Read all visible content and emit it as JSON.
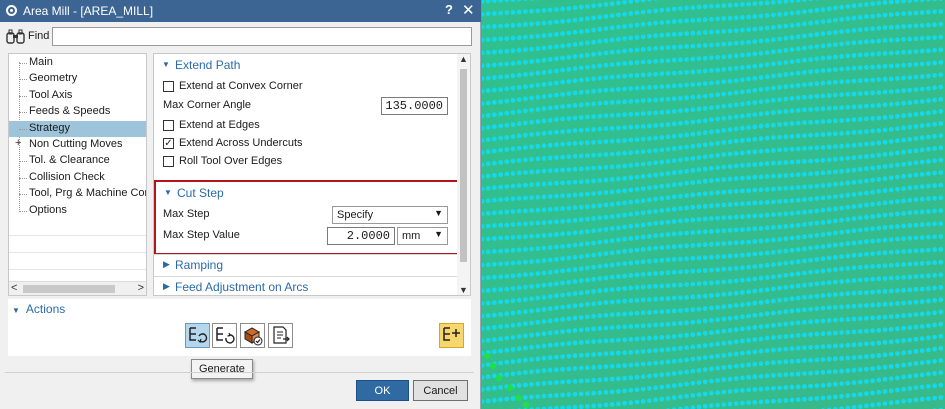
{
  "titlebar": {
    "title": "Area Mill - [AREA_MILL]",
    "help": "?",
    "close": "✕"
  },
  "find": {
    "label": "Find",
    "value": ""
  },
  "tree": {
    "items": [
      {
        "label": "Main",
        "selected": false,
        "expandable": false
      },
      {
        "label": "Geometry",
        "selected": false,
        "expandable": false
      },
      {
        "label": "Tool Axis",
        "selected": false,
        "expandable": false
      },
      {
        "label": "Feeds & Speeds",
        "selected": false,
        "expandable": false
      },
      {
        "label": "Strategy",
        "selected": true,
        "expandable": false
      },
      {
        "label": "Non Cutting Moves",
        "selected": false,
        "expandable": true
      },
      {
        "label": "Tol. & Clearance",
        "selected": false,
        "expandable": false
      },
      {
        "label": "Collision Check",
        "selected": false,
        "expandable": false
      },
      {
        "label": "Tool, Prg & Machine Contr",
        "selected": false,
        "expandable": false
      },
      {
        "label": "Options",
        "selected": false,
        "expandable": false
      }
    ]
  },
  "extend_path": {
    "header": "Extend Path",
    "extend_at_convex_corner": {
      "label": "Extend at Convex Corner",
      "checked": false
    },
    "max_corner_angle": {
      "label": "Max Corner Angle",
      "value": "135.0000"
    },
    "extend_at_edges": {
      "label": "Extend at Edges",
      "checked": false
    },
    "extend_across_undercuts": {
      "label": "Extend Across Undercuts",
      "checked": true
    },
    "roll_tool_over_edges": {
      "label": "Roll Tool Over Edges",
      "checked": false
    }
  },
  "cut_step": {
    "header": "Cut Step",
    "max_step": {
      "label": "Max Step",
      "value": "Specify"
    },
    "max_step_value": {
      "label": "Max Step Value",
      "value": "2.0000",
      "unit": "mm"
    },
    "highlight_color": "#b4141e"
  },
  "ramping": {
    "header": "Ramping"
  },
  "feed_adjustment": {
    "header": "Feed Adjustment on Arcs"
  },
  "actions": {
    "header": "Actions",
    "buttons": [
      "generate-icon",
      "replay-icon",
      "verify-icon",
      "list-icon",
      "toolpath-edit-icon"
    ]
  },
  "tooltip": "Generate",
  "footer": {
    "ok": "OK",
    "cancel": "Cancel"
  },
  "colors": {
    "titlebar": "#3c6593",
    "accent_text": "#2b6aa8",
    "selected_tree": "#9ec4dc",
    "graphics_background": "#2fb98d",
    "toolpath_dots": "#17d8e8"
  }
}
